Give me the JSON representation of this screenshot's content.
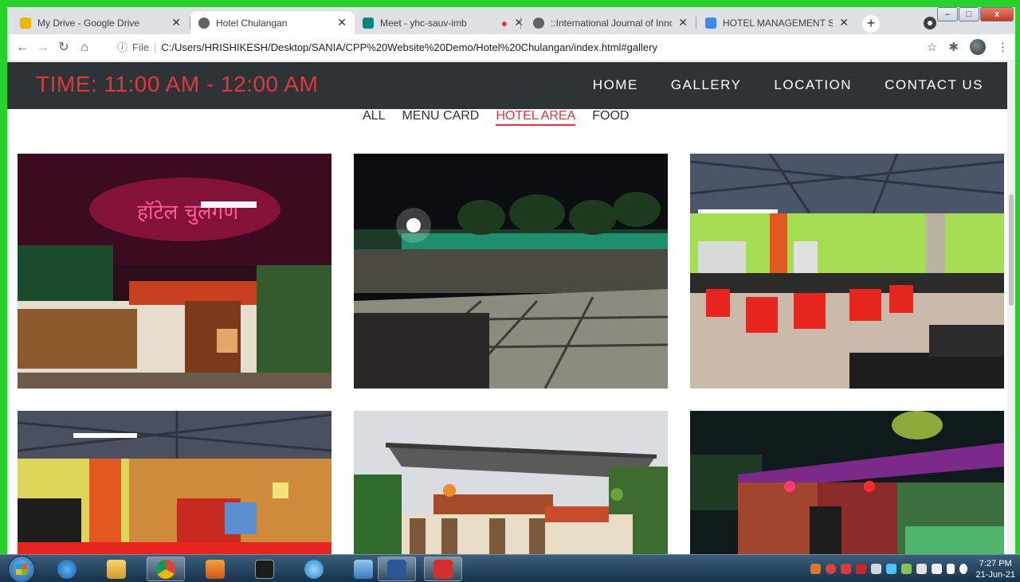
{
  "browser": {
    "tabs": [
      {
        "title": "My Drive - Google Drive",
        "favicon": "google-drive-icon",
        "color": "#f4b400",
        "active": false
      },
      {
        "title": "Hotel Chulangan",
        "favicon": "globe-icon",
        "color": "#5f6368",
        "active": true
      },
      {
        "title": "Meet - yhc-sauv-imb",
        "favicon": "google-meet-icon",
        "color": "#00897b",
        "active": false
      },
      {
        "title": "::International Journal of Innov",
        "favicon": "globe-icon",
        "color": "#5f6368",
        "active": false
      },
      {
        "title": "HOTEL MANAGEMENT SYSTEI",
        "favicon": "google-sites-icon",
        "color": "#4285f4",
        "active": false
      }
    ],
    "new_tab": "+",
    "address": {
      "scheme": "File",
      "url": "C:/Users/HRISHIKESH/Desktop/SANIA/CPP%20Website%20Demo/Hotel%20Chulangan/index.html#gallery"
    }
  },
  "site": {
    "time_label": "TIME: 11:00 AM - 12:00 AM",
    "nav": [
      "HOME",
      "GALLERY",
      "LOCATION",
      "CONTACT US"
    ],
    "filters": [
      "ALL",
      "MENU CARD",
      "HOTEL AREA",
      "FOOD"
    ],
    "active_filter": "HOTEL AREA",
    "gallery": [
      {
        "name": "entrance-neon-sign-photo",
        "sign_text": "हॉटेल चुलंगण"
      },
      {
        "name": "garden-night-photo"
      },
      {
        "name": "dining-hall-photo"
      },
      {
        "name": "dining-hall-interior-photo"
      },
      {
        "name": "shed-exterior-photo"
      },
      {
        "name": "colorful-wall-night-photo"
      }
    ]
  },
  "taskbar": {
    "apps": [
      "start-button",
      "internet-explorer-icon",
      "file-explorer-icon",
      "chrome-icon",
      "media-player-icon",
      "command-prompt-icon",
      "skype-icon",
      "network-icon",
      "word-icon",
      "acrobat-icon"
    ],
    "time": "7:27 PM",
    "date": "21-Jun-21"
  },
  "colors": {
    "header_bg": "#2e3338",
    "accent_red": "#e3363e",
    "frame_green": "#2bd12b"
  }
}
